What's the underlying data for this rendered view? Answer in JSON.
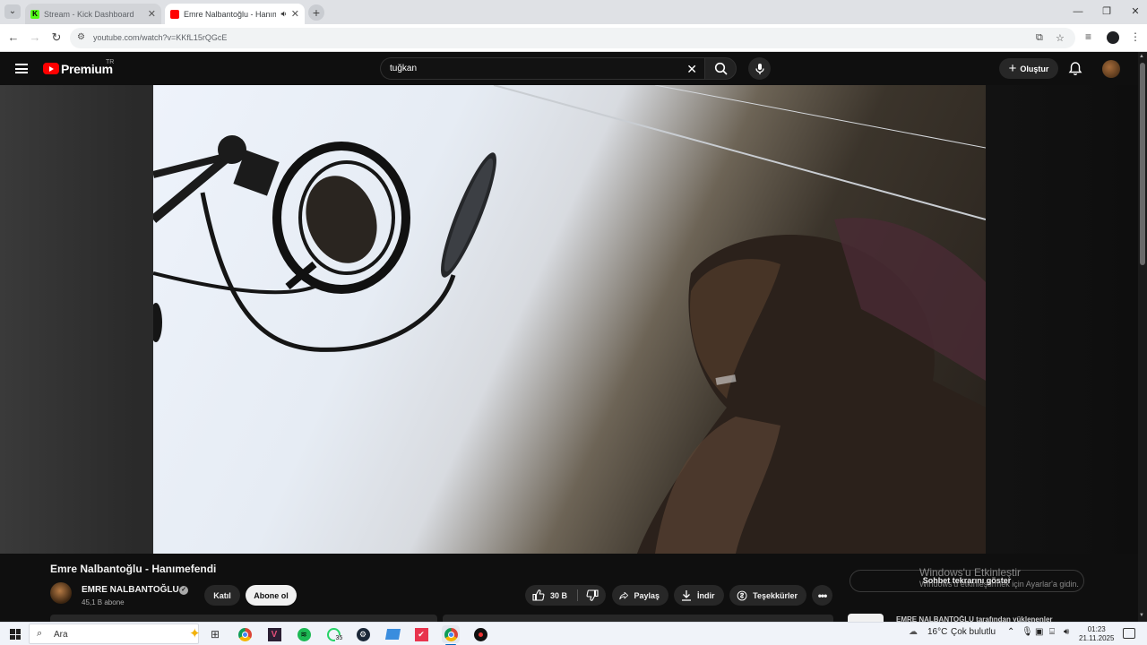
{
  "browser": {
    "tabs": [
      {
        "title": "Stream - Kick Dashboard",
        "active": false,
        "favicon": "kick-icon"
      },
      {
        "title": "Emre Nalbantoğlu - Hanımefendi",
        "active": true,
        "favicon": "youtube-icon"
      }
    ],
    "kick_letter": "K",
    "url": "youtube.com/watch?v=KKfL15rQGcE"
  },
  "youtube": {
    "logo_text": "Premium",
    "region": "TR",
    "search_query": "tuğkan",
    "create_label": "Oluştur"
  },
  "video": {
    "title": "Emre Nalbantoğlu - Hanımefendi",
    "channel_name": "EMRE NALBANTOĞLU",
    "subscribers": "45,1 B abone",
    "join_label": "Katıl",
    "subscribe_label": "Abone ol",
    "likes": "30 B",
    "share_label": "Paylaş",
    "download_label": "İndir",
    "thanks_label": "Teşekkürler",
    "chat_label": "Sohbet tekrarını göster",
    "peek_text": "EMRE NALBANTOĞLU tarafından yüklenenler"
  },
  "watermark": {
    "line1": "Windows'u Etkinleştir",
    "line2": "Windows'u etkinleştirmek için Ayarlar'a gidin."
  },
  "taskbar": {
    "search_placeholder": "Ara",
    "whatsapp_badge": "35",
    "weather_temp": "16°C",
    "weather_desc": "Çok bulutlu",
    "time": "01:23",
    "date": "21.11.2025"
  },
  "colors": {
    "youtube_red": "#ff0000",
    "kick_green": "#53fc18",
    "taskbar_accent": "#0067c0"
  }
}
